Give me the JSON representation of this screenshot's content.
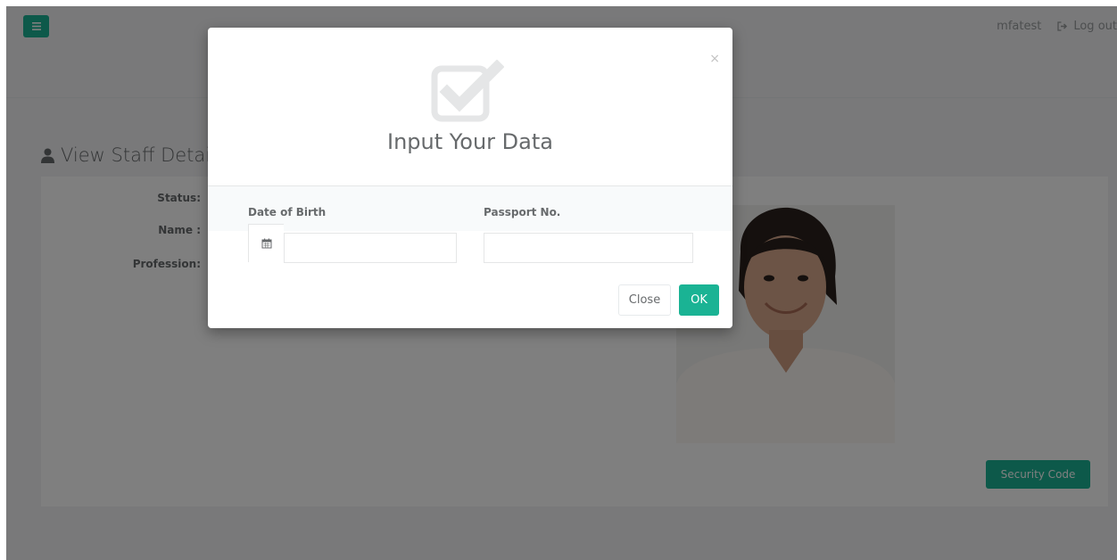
{
  "header": {
    "username": "mfatest",
    "logout_label": "Log out"
  },
  "page": {
    "title": "View Staff Details",
    "fields": [
      {
        "label": "Status:"
      },
      {
        "label": "Name :"
      },
      {
        "label": "Profession:"
      }
    ],
    "security_code_label": "Security Code"
  },
  "modal": {
    "title": "Input Your Data",
    "close_symbol": "×",
    "date_of_birth_label": "Date of Birth",
    "date_of_birth_value": "",
    "passport_label": "Passport No.",
    "passport_value": "",
    "close_button_label": "Close",
    "ok_button_label": "OK"
  },
  "icons": {
    "menu": "hamburger-icon",
    "logout": "sign-out-icon",
    "title": "user-icon",
    "modal_header": "check-square-icon",
    "calendar": "calendar-icon"
  },
  "colors": {
    "accent": "#1ab394",
    "text": "#676a6c",
    "muted": "#999c9e"
  }
}
